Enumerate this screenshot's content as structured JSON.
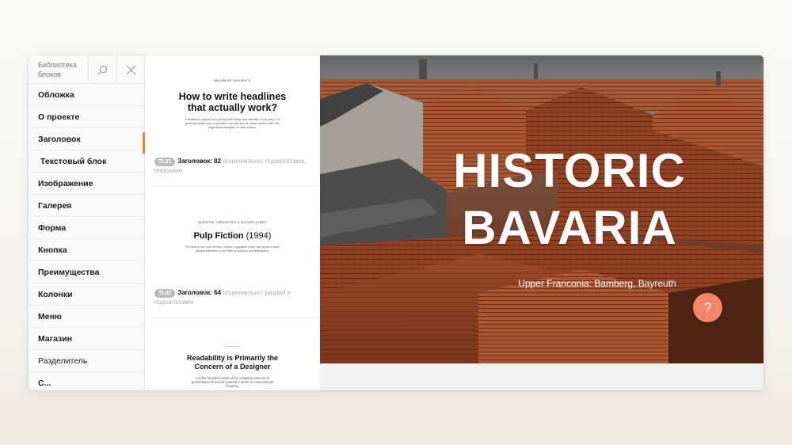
{
  "sidebar": {
    "title": "Библиотека блоков",
    "search_icon": "search-icon",
    "close_icon": "close-icon",
    "items": [
      {
        "label": "Обложка"
      },
      {
        "label": "О проекте"
      },
      {
        "label": "Заголовок",
        "active": true
      },
      {
        "label": "Текстовый блок"
      },
      {
        "label": "Изображение"
      },
      {
        "label": "Галерея"
      },
      {
        "label": "Форма"
      },
      {
        "label": "Кнопка"
      },
      {
        "label": "Преимущества"
      },
      {
        "label": "Колонки"
      },
      {
        "label": "Меню"
      },
      {
        "label": "Магазин"
      },
      {
        "label": "Разделитель"
      },
      {
        "label": "С..."
      }
    ]
  },
  "blocks": [
    {
      "eyebrow": "Maximize insights",
      "title_line1": "How to write headlines",
      "title_line2": "that actually work?",
      "body": "A headline's purpose is to quickly and briefly draw attention to the story. It is generally written by a copy editor, but may also be written by the writer, the page layout designer, or other editors.",
      "code": "TL01",
      "label": "Заголовок: 82",
      "description": "опционально: подзаголовок, описание"
    },
    {
      "eyebrow": "Quentin Tarantino & Roger Avary",
      "title": "Pulp Fiction",
      "year": "(1994)",
      "body": "The lives of two mob hit men, a boxer, a gangster's wife, and a pair of diner bandits intertwine in four tales of violence and redemption.",
      "code": "TL02",
      "label": "Заголовок: 64",
      "description": "опционально: раздел и подзаголовок"
    },
    {
      "title_line1": "Readability is Primarily the",
      "title_line2": "Concern of a Designer",
      "body": "It is the intended result of the complete process of presentation of textual material in order to communicate meaning."
    }
  ],
  "preview": {
    "title_line1": "HISTORIC",
    "title_line2": "BAVARIA",
    "subtitle": "Upper Franconia: Bamberg, Bayreuth"
  },
  "help_button": {
    "label": "?",
    "color": "#f3866a"
  },
  "colors": {
    "accent": "#f47b53"
  }
}
